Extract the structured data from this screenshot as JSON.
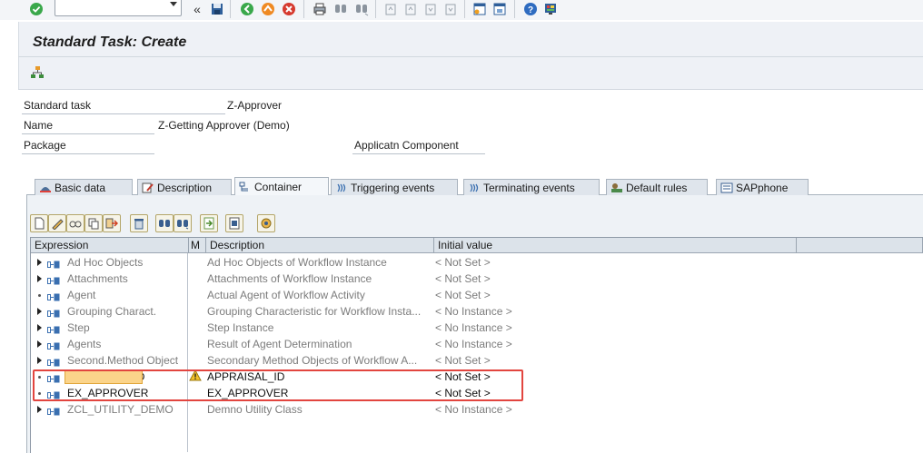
{
  "window": {
    "title": "Standard Task: Create"
  },
  "system_toolbar": {
    "icons": [
      "enter-icon",
      "save-icon",
      "back-icon",
      "exit-icon",
      "cancel-icon",
      "print-icon",
      "find-icon",
      "find-next-icon",
      "first-page-icon",
      "previous-page-icon",
      "next-page-icon",
      "last-page-icon",
      "new-session-icon",
      "shortcut-icon",
      "help-icon",
      "customize-layout-icon"
    ],
    "command_field": ""
  },
  "header_fields": {
    "standard_task_label": "Standard task",
    "standard_task_value": "Z-Approver",
    "name_label": "Name",
    "name_value": "Z-Getting Approver (Demo)",
    "package_label": "Package",
    "app_component_label": "Applicatn Component"
  },
  "tabs": [
    {
      "label": "Basic data",
      "icon": "hat-icon"
    },
    {
      "label": "Description",
      "icon": "edit-icon"
    },
    {
      "label": "Container",
      "icon": "container-icon",
      "active": true
    },
    {
      "label": "Triggering events",
      "icon": "event-icon"
    },
    {
      "label": "Terminating events",
      "icon": "event-icon"
    },
    {
      "label": "Default rules",
      "icon": "rule-icon"
    },
    {
      "label": "SAPphone",
      "icon": "phone-icon"
    }
  ],
  "container_toolbar": [
    "create-icon",
    "change-icon",
    "display-icon",
    "copy-icon",
    "export-icon",
    "delete-icon",
    "find-icon",
    "find-next-icon",
    "import-icon",
    "where-used-icon",
    "settings-icon"
  ],
  "grid": {
    "columns": [
      "Expression",
      "M",
      "Description",
      "Initial value"
    ],
    "rows": [
      {
        "expression": "Ad Hoc Objects",
        "description": "Ad Hoc Objects of Workflow Instance",
        "initial": "< Not Set >",
        "expandable": true,
        "dark": false
      },
      {
        "expression": "Attachments",
        "description": "Attachments of Workflow Instance",
        "initial": "< Not Set >",
        "expandable": true,
        "dark": false
      },
      {
        "expression": "Agent",
        "description": "Actual Agent of Workflow Activity",
        "initial": "< Not Set >",
        "expandable": false,
        "dark": false
      },
      {
        "expression": "Grouping Charact.",
        "description": "Grouping Characteristic for Workflow Insta...",
        "initial": "< No Instance >",
        "expandable": true,
        "dark": false
      },
      {
        "expression": "Step",
        "description": "Step Instance",
        "initial": "< No Instance >",
        "expandable": true,
        "dark": false
      },
      {
        "expression": "Agents",
        "description": "Result of Agent Determination",
        "initial": "< No Instance >",
        "expandable": true,
        "dark": false
      },
      {
        "expression": "Second.Method Object",
        "description": "Secondary Method Objects of Workflow A...",
        "initial": "< Not Set >",
        "expandable": true,
        "dark": false
      },
      {
        "expression": "APPRAISAL_ID",
        "description": "APPRAISAL_ID",
        "initial": "< Not Set >",
        "expandable": false,
        "dark": true,
        "selected": true
      },
      {
        "expression": "EX_APPROVER",
        "description": "EX_APPROVER",
        "initial": "< Not Set >",
        "expandable": false,
        "dark": true
      },
      {
        "expression": "ZCL_UTILITY_DEMO",
        "description": "Demno Utility Class",
        "initial": "< No Instance >",
        "expandable": true,
        "dark": false
      }
    ]
  },
  "colors": {
    "highlight_border": "#e2453f",
    "selected_cell": "#fbd48a",
    "tab_bg": "#dfe5ec"
  }
}
